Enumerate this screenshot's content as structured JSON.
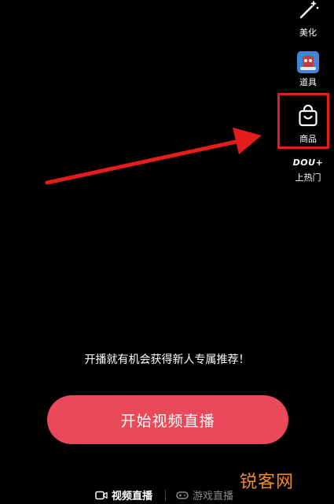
{
  "toolbar": {
    "beauty_label": "美化",
    "props_label": "道具",
    "goods_label": "商品",
    "hot_logo": "DOU+",
    "hot_label": "上热门"
  },
  "promo_text": "开播就有机会获得新人专属推荐！",
  "start_button_label": "开始视频直播",
  "mode_tabs": {
    "video": "视频直播",
    "game": "游戏直播"
  },
  "watermark": "锐客网",
  "colors": {
    "background": "#000000",
    "start_button": "#e94958",
    "annotation_red": "#e31c1c",
    "watermark": "#f08a2a"
  },
  "icons": {
    "beauty": "magic-wand-icon",
    "props": "robot-sticker-icon",
    "goods": "shopping-bag-icon",
    "video": "video-camera-icon",
    "game": "gamepad-icon"
  }
}
